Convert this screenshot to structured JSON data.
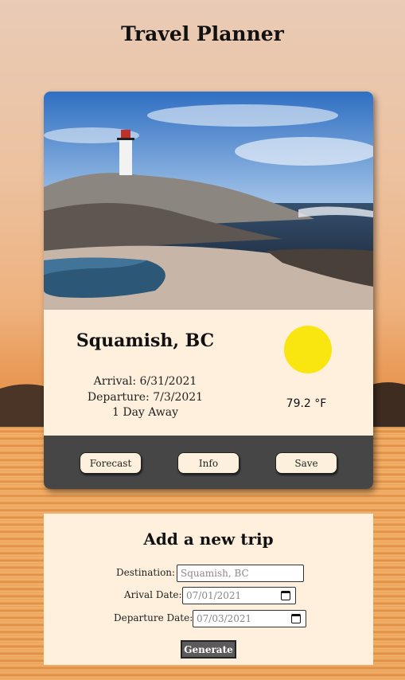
{
  "app": {
    "title": "Travel Planner"
  },
  "trip_card": {
    "city": "Squamish, BC",
    "arrival": "Arrival: 6/31/2021",
    "departure": "Departure: 7/3/2021",
    "days_away": "1 Day Away",
    "temperature": "79.2 °F",
    "weather_icon": "sun-icon",
    "sun_color": "#f9e50f",
    "buttons": {
      "forecast": "Forecast",
      "info": "Info",
      "save": "Save"
    }
  },
  "new_trip_form": {
    "title": "Add a new trip",
    "destination": {
      "label": "Destination:",
      "value": "Squamish, BC"
    },
    "arrival_date": {
      "label": "Arival Date:",
      "value": "07/01/2021"
    },
    "departure_date": {
      "label": "Departure Date:",
      "value": "07/03/2021"
    },
    "submit_label": "Generate"
  },
  "colors": {
    "card_background": "#fef0dc",
    "button_bar": "#464646",
    "generate_button": "#5b5b5b"
  }
}
